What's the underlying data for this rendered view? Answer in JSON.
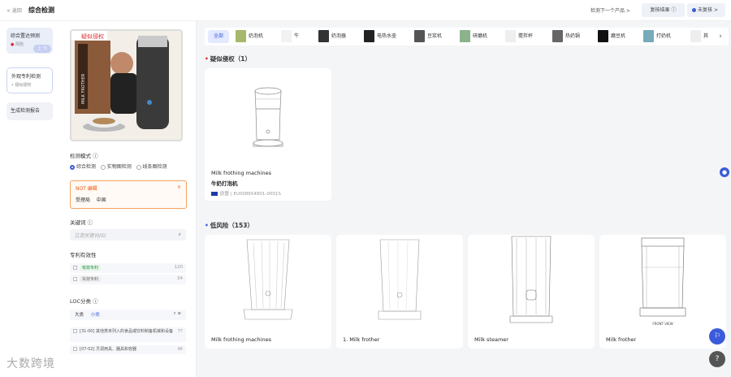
{
  "header": {
    "back": "< 返回",
    "title": "综合检测",
    "next_product": "检测下一个产品 >",
    "review_results": "复核结果 ⓘ",
    "unreviewed": "未复核",
    "unreviewed_arrow": ">"
  },
  "nav": {
    "items": [
      {
        "label": "综合置达预测",
        "sub": "风险",
        "pill": "上 ℃"
      },
      {
        "label": "外观专利检测",
        "sub": "• 疑似侵权"
      },
      {
        "label": "生成检测报告"
      }
    ]
  },
  "product_image": {
    "badge": "疑似侵权",
    "box_text": "MILK FROTHER"
  },
  "filters": {
    "mode_label": "检测模式 ⓘ",
    "modes": [
      "综合检测",
      "实物图检测",
      "线条图检测"
    ],
    "not_label": "NOT 编辑",
    "office_label": "受理局",
    "office_value": "中国",
    "close": "×",
    "keyword_label": "关键词 ⓘ",
    "keyword_placeholder": "过滤关键词/ID",
    "validity_label": "专利有效性",
    "validity": [
      {
        "label": "有效专利",
        "count": "120"
      },
      {
        "label": "失效专利",
        "count": "34"
      }
    ],
    "loc_label": "LOC分类 ⓘ",
    "loc_tabs": [
      "大类",
      "小类"
    ],
    "loc_items": [
      {
        "label": "[31-00] 其他类未列入的食品或饮料制备机械和设备",
        "count": "77"
      },
      {
        "label": "[07-02] 烹调用具、器具和容器",
        "count": "46"
      }
    ]
  },
  "categories": [
    "全部",
    "奶泡机",
    "牛",
    "奶泡器",
    "电热水壶",
    "豆浆机",
    "研磨机",
    "搅拌杯",
    "热奶锅",
    "磨豆机",
    "打奶机",
    "其"
  ],
  "sections": {
    "infringe": {
      "title": "疑似侵权（1）"
    },
    "low": {
      "title": "低风险（153）"
    }
  },
  "infringe_cards": [
    {
      "title": "Milk frothing machines",
      "subtitle": "牛奶打泡机",
      "region": "欧盟",
      "id": "EU008654801-0001S"
    }
  ],
  "low_cards": [
    {
      "title": "Milk frothing machines"
    },
    {
      "title": "1. Milk frother"
    },
    {
      "title": "Milk steamer"
    },
    {
      "title": "Milk frother",
      "caption": "FRONT VIEW"
    }
  ],
  "watermark": "大数跨境",
  "colors": {
    "accent": "#3b5bdb",
    "danger": "#e03131",
    "warn": "#e8590c"
  }
}
